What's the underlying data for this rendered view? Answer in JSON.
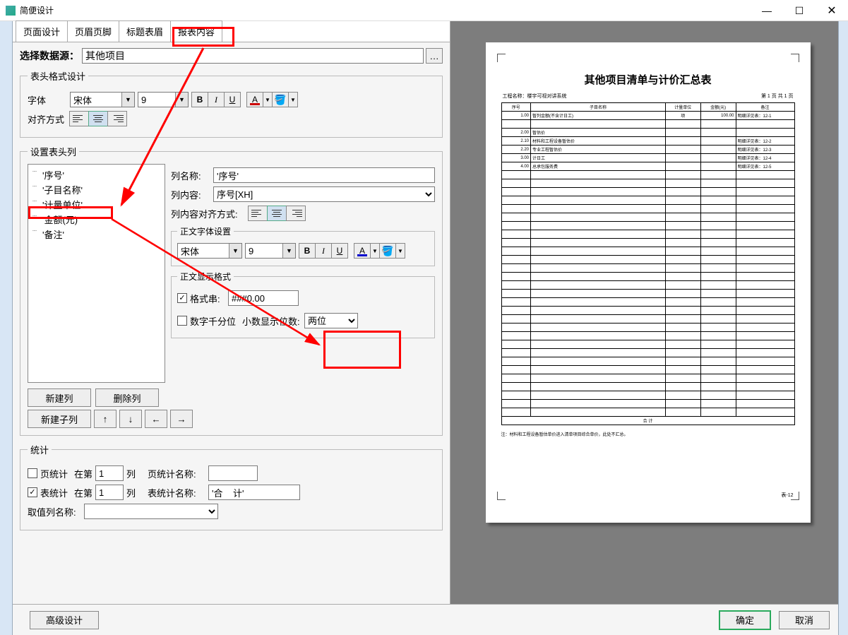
{
  "window_title": "简便设计",
  "tabs": [
    "页面设计",
    "页眉页脚",
    "标题表眉",
    "报表内容"
  ],
  "active_tab": 3,
  "data_source": {
    "label": "选择数据源：",
    "value": "其他项目"
  },
  "header_format": {
    "legend": "表头格式设计",
    "font_label": "字体",
    "font_family": "宋体",
    "font_size": "9",
    "align_label": "对齐方式"
  },
  "header_columns": {
    "legend": "设置表头列",
    "items": [
      "'序号'",
      "'子目名称'",
      "'计量单位'",
      "'金额(元)'",
      "'备注'"
    ],
    "selected": 3,
    "col_name_label": "列名称:",
    "col_name_value": "'序号'",
    "col_content_label": "列内容:",
    "col_content_value": "序号[XH]",
    "col_align_label": "列内容对齐方式:",
    "body_font_legend": "正文字体设置",
    "body_font_family": "宋体",
    "body_font_size": "9",
    "display_format_legend": "正文显示格式",
    "format_str_checked": true,
    "format_str_label": "格式串:",
    "format_str_value": "###0.00",
    "thousand_sep_checked": false,
    "thousand_sep_label": "数字千分位",
    "decimal_label": "小数显示位数:",
    "decimal_value": "两位",
    "btn_new_col": "新建列",
    "btn_del_col": "删除列",
    "btn_new_subcol": "新建子列"
  },
  "stats": {
    "legend": "统计",
    "page_stat_checked": false,
    "page_stat_label": "页统计",
    "at_col": "在第",
    "col_suffix": "列",
    "page_stat_num": "1",
    "page_stat_name_label": "页统计名称:",
    "page_stat_name_value": "",
    "table_stat_checked": true,
    "table_stat_label": "表统计",
    "table_stat_num": "1",
    "table_stat_name_label": "表统计名称:",
    "table_stat_name_value": "'合    计'",
    "value_col_label": "取值列名称:"
  },
  "footer": {
    "adv": "高级设计",
    "ok": "确定",
    "cancel": "取消"
  },
  "preview": {
    "title": "其他项目清单与计价汇总表",
    "project_label": "工程名称：楼宇可视对讲系统",
    "page_info": "第 1 页 共 1 页",
    "headers": [
      "序号",
      "子目名称",
      "计量单位",
      "金额(元)",
      "备注"
    ],
    "rows": [
      {
        "c0": "1.00",
        "c1": "暂列金额(不含计日工)",
        "c2": "项",
        "c3": "100.00",
        "c4": "明细详见表：12-1"
      },
      {
        "blank": true
      },
      {
        "c0": "2.00",
        "c1": "暂估价",
        "c2": "",
        "c3": "",
        "c4": ""
      },
      {
        "c0": "2.10",
        "c1": "材料和工程设备暂估价",
        "c2": "",
        "c3": "",
        "c4": "明细详见表：12-2"
      },
      {
        "c0": "2.20",
        "c1": "专业工程暂估价",
        "c2": "",
        "c3": "",
        "c4": "明细详见表：12-3"
      },
      {
        "c0": "3.00",
        "c1": "计日工",
        "c2": "",
        "c3": "",
        "c4": "明细详见表：12-4"
      },
      {
        "c0": "4.00",
        "c1": "总承包服务费",
        "c2": "",
        "c3": "",
        "c4": "明细详见表：12-5"
      }
    ],
    "foot": "合    计",
    "empty_rows": 29,
    "note": "注：材料和工程设备暂估单价进入清单项目综合单价，此处不汇总。",
    "page_no": "表-12"
  }
}
